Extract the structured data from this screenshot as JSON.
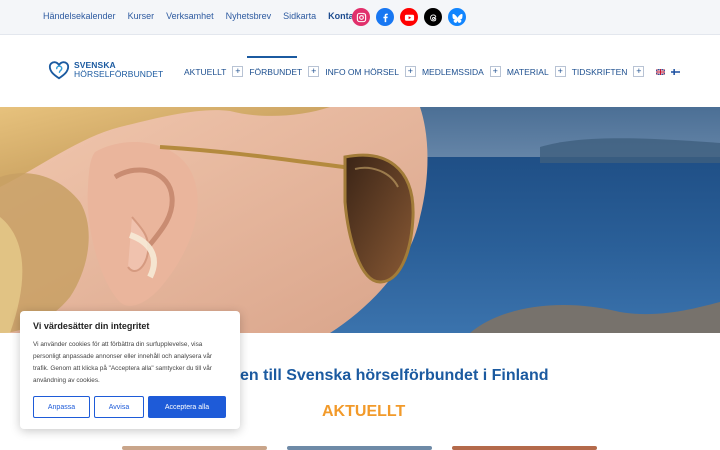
{
  "topbar": {
    "links": [
      "Händelsekalender",
      "Kurser",
      "Verksamhet",
      "Nyhetsbrev",
      "Sidkarta"
    ],
    "contact": "Kontakt",
    "social": [
      {
        "icon": "instagram-icon",
        "color": "#e1306c"
      },
      {
        "icon": "facebook-icon",
        "color": "#1877f2"
      },
      {
        "icon": "youtube-icon",
        "color": "#ff0000"
      },
      {
        "icon": "threads-icon",
        "color": "#000000"
      },
      {
        "icon": "bluesky-icon",
        "color": "#1185fe"
      }
    ]
  },
  "header": {
    "logo": {
      "line1": "SVENSKA",
      "line2": "HÖRSELFÖRBUNDET"
    },
    "nav": [
      {
        "label": "AKTUELLT"
      },
      {
        "label": "FÖRBUNDET"
      },
      {
        "label": "INFO OM HÖRSEL"
      },
      {
        "label": "MEDLEMSSIDA"
      },
      {
        "label": "MATERIAL"
      },
      {
        "label": "TIDSKRIFTEN"
      }
    ],
    "active_nav": "FÖRBUNDET",
    "languages": [
      "english-flag-icon",
      "finnish-flag-icon"
    ]
  },
  "main": {
    "headline": "en till Svenska hörselförbundet i Finland",
    "section_title": "AKTUELLT"
  },
  "cookie": {
    "title": "Vi värdesätter din integritet",
    "text": "Vi använder cookies för att förbättra din surfupplevelse, visa personligt anpassade annonser eller innehåll och analysera vår trafik. Genom att klicka på \"Acceptera alla\" samtycker du till vår användning av cookies.",
    "buttons": {
      "customize": "Anpassa",
      "reject": "Avvisa",
      "accept": "Acceptera alla"
    }
  },
  "colors": {
    "brand": "#1b5aa0",
    "accent": "#f29a2a",
    "button": "#1e5bd8"
  }
}
